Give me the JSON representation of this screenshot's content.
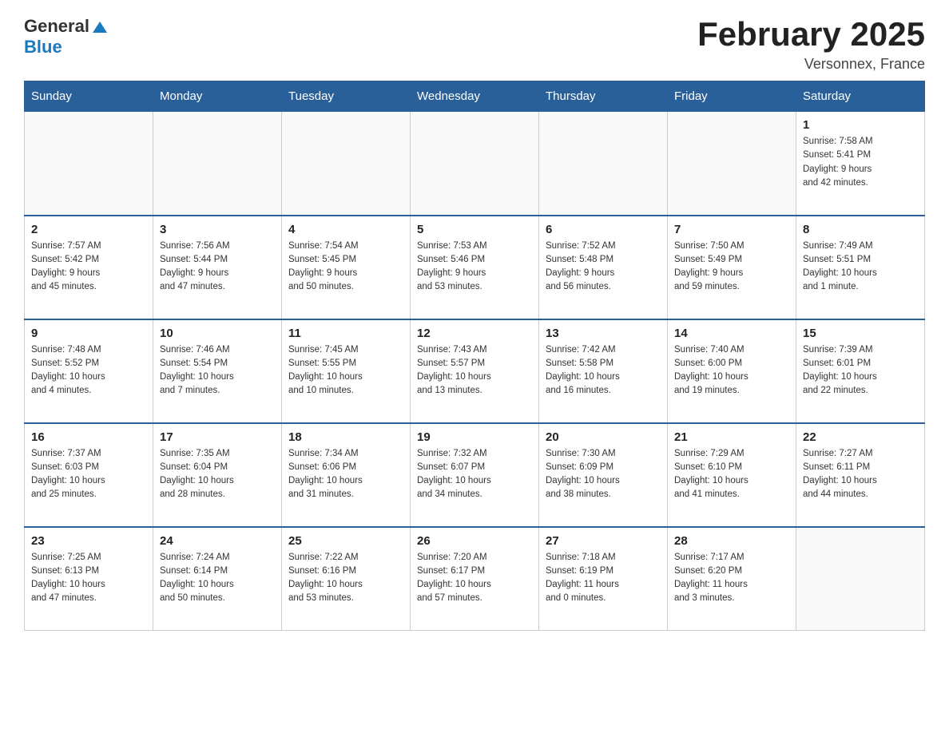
{
  "header": {
    "logo_general": "General",
    "logo_blue": "Blue",
    "month_title": "February 2025",
    "location": "Versonnex, France"
  },
  "weekdays": [
    "Sunday",
    "Monday",
    "Tuesday",
    "Wednesday",
    "Thursday",
    "Friday",
    "Saturday"
  ],
  "weeks": [
    [
      {
        "day": "",
        "info": ""
      },
      {
        "day": "",
        "info": ""
      },
      {
        "day": "",
        "info": ""
      },
      {
        "day": "",
        "info": ""
      },
      {
        "day": "",
        "info": ""
      },
      {
        "day": "",
        "info": ""
      },
      {
        "day": "1",
        "info": "Sunrise: 7:58 AM\nSunset: 5:41 PM\nDaylight: 9 hours\nand 42 minutes."
      }
    ],
    [
      {
        "day": "2",
        "info": "Sunrise: 7:57 AM\nSunset: 5:42 PM\nDaylight: 9 hours\nand 45 minutes."
      },
      {
        "day": "3",
        "info": "Sunrise: 7:56 AM\nSunset: 5:44 PM\nDaylight: 9 hours\nand 47 minutes."
      },
      {
        "day": "4",
        "info": "Sunrise: 7:54 AM\nSunset: 5:45 PM\nDaylight: 9 hours\nand 50 minutes."
      },
      {
        "day": "5",
        "info": "Sunrise: 7:53 AM\nSunset: 5:46 PM\nDaylight: 9 hours\nand 53 minutes."
      },
      {
        "day": "6",
        "info": "Sunrise: 7:52 AM\nSunset: 5:48 PM\nDaylight: 9 hours\nand 56 minutes."
      },
      {
        "day": "7",
        "info": "Sunrise: 7:50 AM\nSunset: 5:49 PM\nDaylight: 9 hours\nand 59 minutes."
      },
      {
        "day": "8",
        "info": "Sunrise: 7:49 AM\nSunset: 5:51 PM\nDaylight: 10 hours\nand 1 minute."
      }
    ],
    [
      {
        "day": "9",
        "info": "Sunrise: 7:48 AM\nSunset: 5:52 PM\nDaylight: 10 hours\nand 4 minutes."
      },
      {
        "day": "10",
        "info": "Sunrise: 7:46 AM\nSunset: 5:54 PM\nDaylight: 10 hours\nand 7 minutes."
      },
      {
        "day": "11",
        "info": "Sunrise: 7:45 AM\nSunset: 5:55 PM\nDaylight: 10 hours\nand 10 minutes."
      },
      {
        "day": "12",
        "info": "Sunrise: 7:43 AM\nSunset: 5:57 PM\nDaylight: 10 hours\nand 13 minutes."
      },
      {
        "day": "13",
        "info": "Sunrise: 7:42 AM\nSunset: 5:58 PM\nDaylight: 10 hours\nand 16 minutes."
      },
      {
        "day": "14",
        "info": "Sunrise: 7:40 AM\nSunset: 6:00 PM\nDaylight: 10 hours\nand 19 minutes."
      },
      {
        "day": "15",
        "info": "Sunrise: 7:39 AM\nSunset: 6:01 PM\nDaylight: 10 hours\nand 22 minutes."
      }
    ],
    [
      {
        "day": "16",
        "info": "Sunrise: 7:37 AM\nSunset: 6:03 PM\nDaylight: 10 hours\nand 25 minutes."
      },
      {
        "day": "17",
        "info": "Sunrise: 7:35 AM\nSunset: 6:04 PM\nDaylight: 10 hours\nand 28 minutes."
      },
      {
        "day": "18",
        "info": "Sunrise: 7:34 AM\nSunset: 6:06 PM\nDaylight: 10 hours\nand 31 minutes."
      },
      {
        "day": "19",
        "info": "Sunrise: 7:32 AM\nSunset: 6:07 PM\nDaylight: 10 hours\nand 34 minutes."
      },
      {
        "day": "20",
        "info": "Sunrise: 7:30 AM\nSunset: 6:09 PM\nDaylight: 10 hours\nand 38 minutes."
      },
      {
        "day": "21",
        "info": "Sunrise: 7:29 AM\nSunset: 6:10 PM\nDaylight: 10 hours\nand 41 minutes."
      },
      {
        "day": "22",
        "info": "Sunrise: 7:27 AM\nSunset: 6:11 PM\nDaylight: 10 hours\nand 44 minutes."
      }
    ],
    [
      {
        "day": "23",
        "info": "Sunrise: 7:25 AM\nSunset: 6:13 PM\nDaylight: 10 hours\nand 47 minutes."
      },
      {
        "day": "24",
        "info": "Sunrise: 7:24 AM\nSunset: 6:14 PM\nDaylight: 10 hours\nand 50 minutes."
      },
      {
        "day": "25",
        "info": "Sunrise: 7:22 AM\nSunset: 6:16 PM\nDaylight: 10 hours\nand 53 minutes."
      },
      {
        "day": "26",
        "info": "Sunrise: 7:20 AM\nSunset: 6:17 PM\nDaylight: 10 hours\nand 57 minutes."
      },
      {
        "day": "27",
        "info": "Sunrise: 7:18 AM\nSunset: 6:19 PM\nDaylight: 11 hours\nand 0 minutes."
      },
      {
        "day": "28",
        "info": "Sunrise: 7:17 AM\nSunset: 6:20 PM\nDaylight: 11 hours\nand 3 minutes."
      },
      {
        "day": "",
        "info": ""
      }
    ]
  ]
}
